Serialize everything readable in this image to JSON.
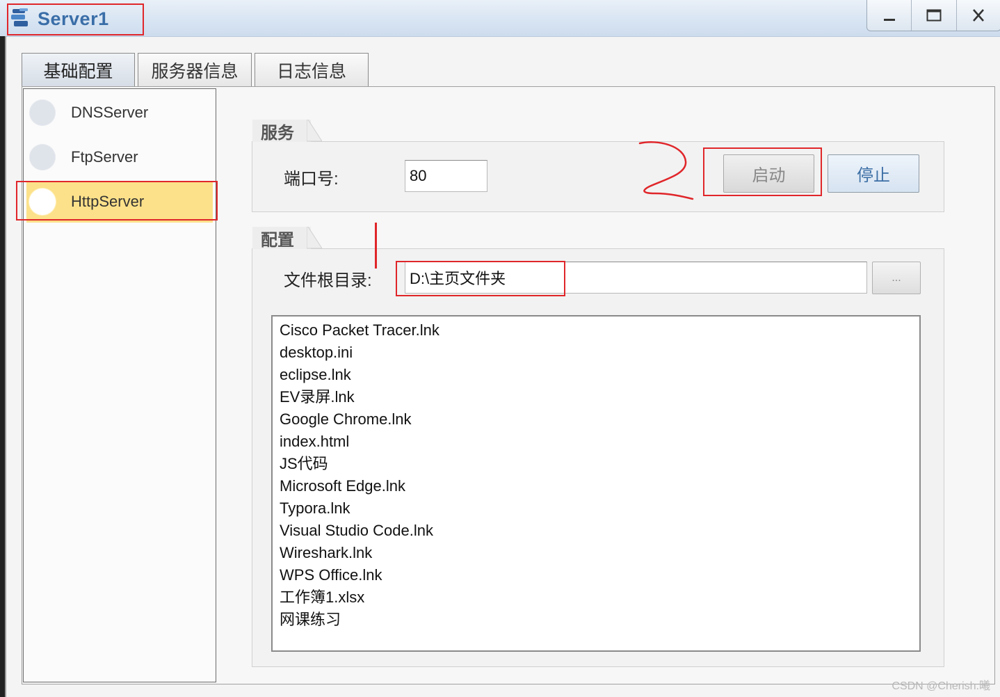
{
  "window": {
    "title": "Server1",
    "controls": {
      "minimize": "—",
      "maximize": "▭",
      "close": "X"
    }
  },
  "tabs": [
    "基础配置",
    "服务器信息",
    "日志信息"
  ],
  "active_tab": 0,
  "sidebar": {
    "items": [
      {
        "label": "DNSServer",
        "selected": false
      },
      {
        "label": "FtpServer",
        "selected": false
      },
      {
        "label": "HttpServer",
        "selected": true
      }
    ]
  },
  "service": {
    "section_title": "服务",
    "port_label": "端口号:",
    "port_value": "80",
    "start_label": "启动",
    "stop_label": "停止"
  },
  "config": {
    "section_title": "配置",
    "root_label": "文件根目录:",
    "root_value": "D:\\主页文件夹",
    "browse_label": "...",
    "files": [
      "Cisco Packet Tracer.lnk",
      "desktop.ini",
      "eclipse.lnk",
      "EV录屏.lnk",
      "Google Chrome.lnk",
      "index.html",
      "JS代码",
      "Microsoft Edge.lnk",
      "Typora.lnk",
      "Visual Studio Code.lnk",
      "Wireshark.lnk",
      "WPS Office.lnk",
      "工作簿1.xlsx",
      "网课练习"
    ]
  },
  "annotation": {
    "mark": "2",
    "color": "#e0262a"
  },
  "watermark": "CSDN @Cherish.曦"
}
